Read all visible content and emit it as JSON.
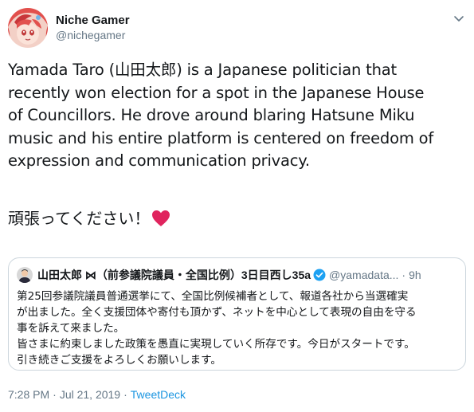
{
  "author": {
    "name": "Niche Gamer",
    "handle": "@nichegamer"
  },
  "tweet": {
    "lines": [
      "Yamada Taro (山田太郎) is a Japanese politician that",
      "recently won election for a spot in the Japanese House",
      "of Councillors. He drove around blaring Hatsune Miku",
      "music and his entire platform is centered on freedom of",
      "expression and communication privacy."
    ],
    "jp_text": "頑張ってください！",
    "emoji": "heart-icon"
  },
  "quoted": {
    "name": "山田太郎 ⋈（前参議院議員・全国比例）3日目西し35a",
    "handle": "@yamadata...",
    "dot": "·",
    "time": "9h",
    "lines": [
      "第25回参議院議員普通選挙にて、全国比例候補者として、報道各社から当選確実",
      "が出ました。全く支援団体や寄付も頂かず、ネットを中心として表現の自由を守る",
      "事を訴えて来ました。",
      "皆さまに約束しました政策を愚直に実現していく所存です。今日がスタートです。",
      "引き続きご支援をよろしくお願いします。"
    ]
  },
  "meta": {
    "time": "7:28 PM",
    "sep1": "·",
    "date": "Jul 21, 2019",
    "sep2": "·",
    "source": "TweetDeck"
  },
  "colors": {
    "text": "#14171a",
    "secondary": "#657786",
    "link": "#1b95e0",
    "border": "#ccd6dd",
    "heart": "#e0245e",
    "verified": "#1da1f2"
  }
}
